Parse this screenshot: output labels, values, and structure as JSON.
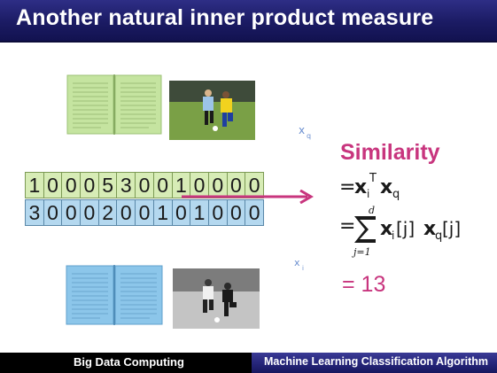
{
  "slide": {
    "title": "Another natural inner product measure",
    "similarity_label": "Similarity",
    "result": "= 13"
  },
  "vectors": {
    "query": [
      "1",
      "0",
      "0",
      "0",
      "5",
      "3",
      "0",
      "0",
      "1",
      "0",
      "0",
      "0",
      "0"
    ],
    "item": [
      "3",
      "0",
      "0",
      "0",
      "2",
      "0",
      "0",
      "1",
      "0",
      "1",
      "0",
      "0",
      "0"
    ]
  },
  "annotations": {
    "xq": "x",
    "xq_sub": "q",
    "xi": "x",
    "xi_sub": "i"
  },
  "formula": {
    "eq1_prefix": "=",
    "bold_x": "x",
    "sub_i": "i",
    "sup_t": "T",
    "sub_q": "q",
    "sum_upper": "d",
    "sum_lower": "j=1",
    "index_j": "[j]"
  },
  "footer": {
    "left": "Big Data Computing",
    "right": "Machine Learning Classification Algorithm"
  },
  "colors": {
    "title_bar": "#1b1b63",
    "accent_pink": "#c8357e",
    "query_cell": "#d7ecb6",
    "item_cell": "#b4d8ef",
    "green_book": "#c5e4a0",
    "blue_book": "#8cc6ea"
  }
}
